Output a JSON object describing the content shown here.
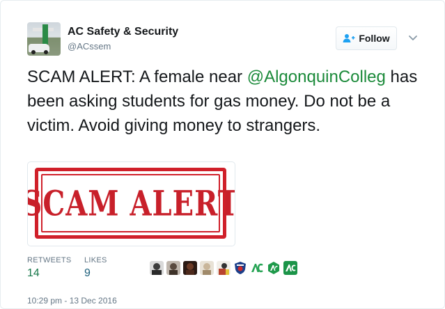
{
  "header": {
    "display_name": "AC Safety & Security",
    "handle": "@ACssem",
    "follow_label": "Follow"
  },
  "tweet": {
    "text_before": "SCAM ALERT: A female near ",
    "mention": "@AlgonquinColleg",
    "text_after": " has been asking students for gas money. Do not be a victim. Avoid giving money to strangers.",
    "image_text": "SCAM ALERT"
  },
  "stats": {
    "retweets_label": "RETWEETS",
    "retweets_count": "14",
    "likes_label": "LIKES",
    "likes_count": "9"
  },
  "likers": [
    {
      "name": "liker-avatar-1",
      "color": "#3b3b3b"
    },
    {
      "name": "liker-avatar-2",
      "color": "#5a4a3f"
    },
    {
      "name": "liker-avatar-3",
      "color": "#4d2a1c"
    },
    {
      "name": "liker-avatar-4",
      "color": "#c9b69a"
    },
    {
      "name": "liker-avatar-5",
      "color": "#b9442f"
    },
    {
      "name": "liker-avatar-police",
      "color": "#1c3f8a"
    },
    {
      "name": "liker-avatar-ac-1",
      "color": "#27a455"
    },
    {
      "name": "liker-avatar-ac-2",
      "color": "#1f9a4b"
    },
    {
      "name": "liker-avatar-ac-3",
      "color": "#1b9448"
    }
  ],
  "timestamp": "10:29 pm - 13 Dec 2016",
  "colors": {
    "mention": "#1b8a3a",
    "stamp_red": "#c8202a",
    "muted": "#657786"
  }
}
